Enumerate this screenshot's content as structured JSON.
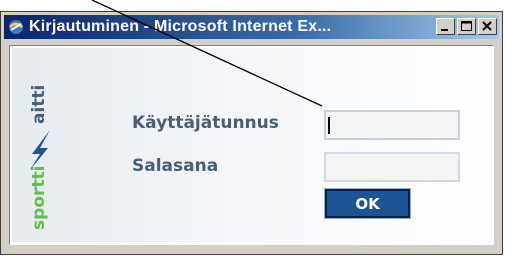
{
  "window": {
    "title": "Kirjautuminen - Microsoft Internet Ex...",
    "app_icon": "internet-explorer-icon",
    "controls": {
      "minimize_icon": "minimize-icon",
      "maximize_icon": "maximize-icon",
      "close_icon": "close-icon"
    }
  },
  "logo": {
    "text": "sporttiSaitti",
    "icon": "sporttisaitti-logo"
  },
  "form": {
    "username_label": "Käyttäjätunnus",
    "username_value": "",
    "password_label": "Salasana",
    "password_value": "",
    "ok_label": "OK"
  },
  "colors": {
    "title_bar": "#0a246a",
    "label_text": "#4a5e74",
    "ok_button": "#1c5496",
    "logo_green": "#5cc43c"
  }
}
